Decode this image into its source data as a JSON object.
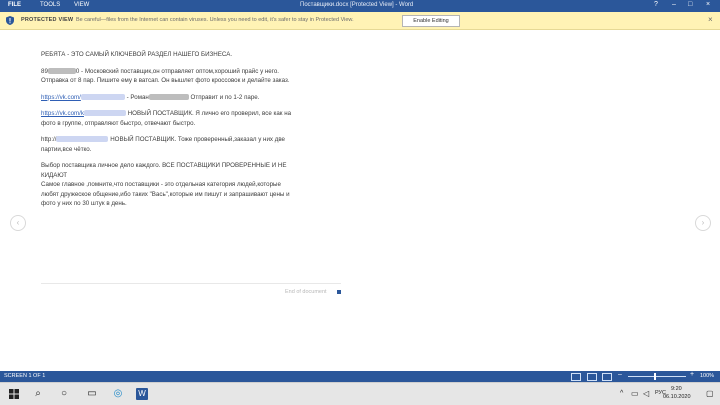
{
  "window": {
    "tabs": [
      "FILE",
      "TOOLS",
      "VIEW"
    ],
    "title": "Поставщики.docx [Protected View] - Word",
    "controls": {
      "help": "?",
      "minimize": "–",
      "maximize": "□",
      "close": "×"
    }
  },
  "protected_view": {
    "label": "PROTECTED VIEW",
    "message": "Be careful—files from the Internet can contain viruses. Unless you need to edit, it's safer to stay in Protected View.",
    "button": "Enable Editing",
    "close": "×"
  },
  "document": {
    "heading": "РЕБЯТА - ЭТО САМЫЙ КЛЮЧЕВОЙ РАЗДЕЛ НАШЕГО БИЗНЕСА.",
    "p1_prefix": "89",
    "p1_suffix": "0 - Московский поставщик,он отправляет оптом,хороший прайс у него.",
    "p1_line2": "Отправка от 8 пар. Пишите ему в ватсап. Он вышлет фото кроссовок и делайте заказ.",
    "link1": "https://vk.com/",
    "p2_mid": "- Роман",
    "p2_tail": "Отправит и по 1-2 паре.",
    "link2": "https://vk.com/k",
    "p3_tail": "НОВЫЙ ПОСТАВЩИК. Я лично его проверил, все как на",
    "p3_line2": "фото в группе, отправляют быстро, отвечают быстро.",
    "link3_prefix": "http://",
    "p4_tail": "НОВЫЙ ПОСТАВЩИК. Тоже проверенный,заказал у них две",
    "p4_line2": "партии,все чётко.",
    "bold_line1": "Выбор поставщика личное дело каждого. ВСЕ ПОСТАВЩИКИ ПРОВЕРЕННЫЕ И НЕ",
    "bold_line2": "КИДАЮТ",
    "p5_line1": "Самое главное ,помните,что поставщики - это отдельная категория людей,которые",
    "p5_line2": "любят дружеское общение,ибо таких \"Вась\",которые им пишут и запрашивают цены и",
    "p5_line3": "фото у них по 30 штук в день.",
    "end_label": "End of document"
  },
  "status": {
    "screen": "SCREEN 1 OF 1",
    "zoom": "100%"
  },
  "taskbar": {
    "lang": "РУС",
    "time": "9:20",
    "date": "06.10.2020"
  },
  "colors": {
    "accent": "#2b579a",
    "banner": "#fff3b5"
  }
}
